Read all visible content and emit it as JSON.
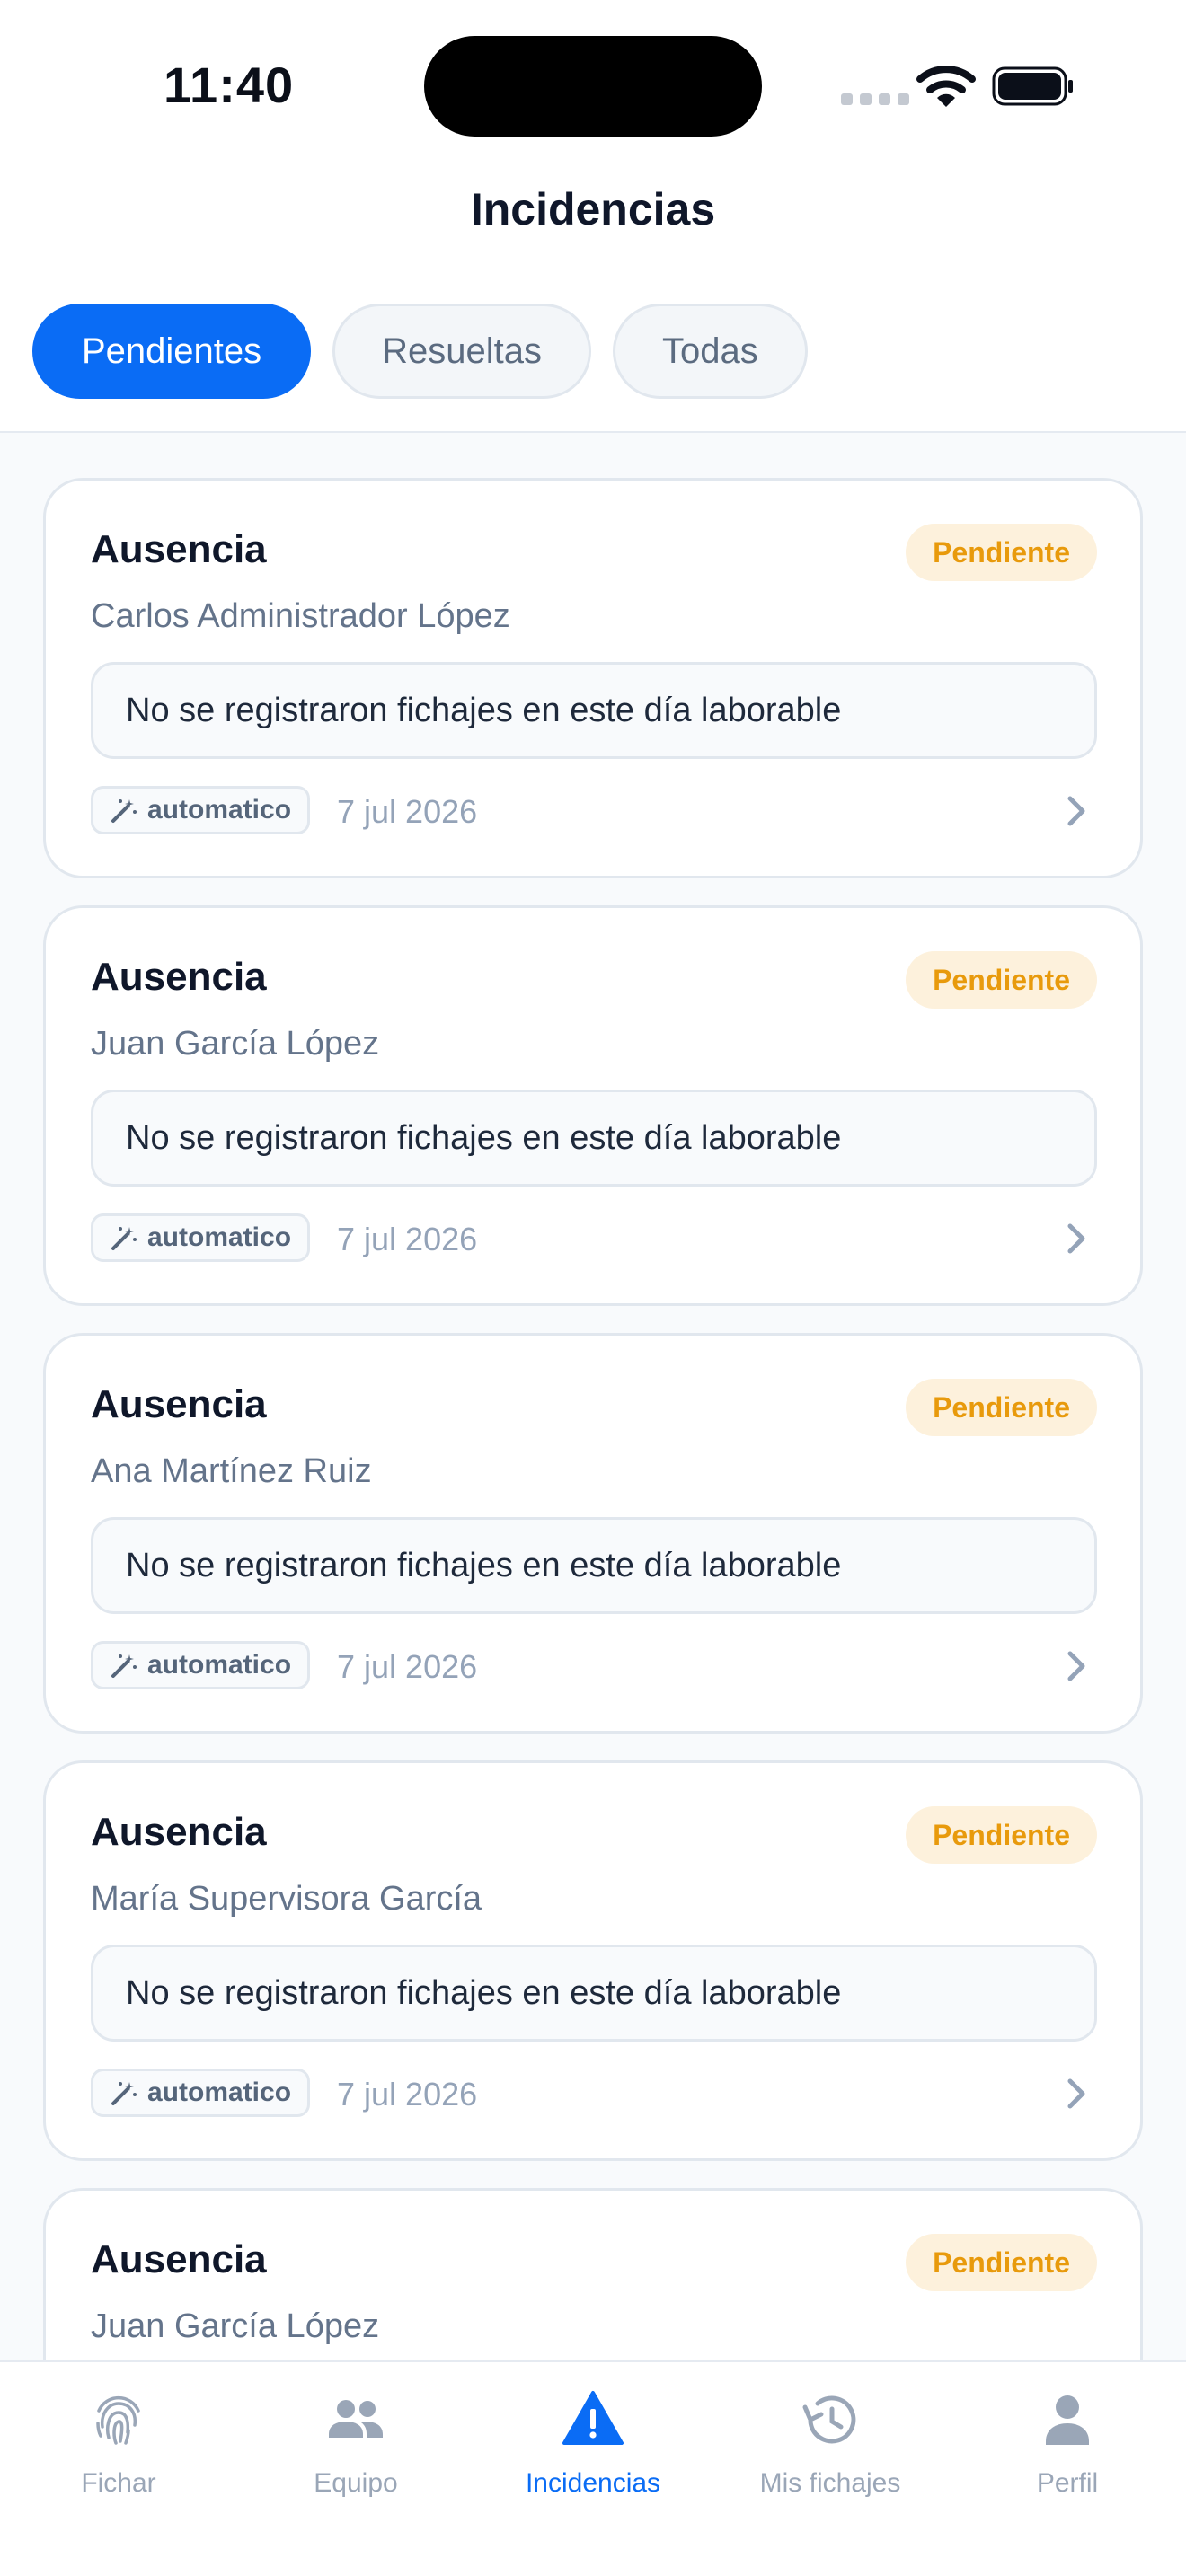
{
  "status_bar": {
    "time": "11:40"
  },
  "header": {
    "title": "Incidencias"
  },
  "tabs": [
    {
      "label": "Pendientes",
      "active": true
    },
    {
      "label": "Resueltas",
      "active": false
    },
    {
      "label": "Todas",
      "active": false
    }
  ],
  "cards": [
    {
      "type": "Ausencia",
      "status": "Pendiente",
      "person": "Carlos Administrador López",
      "description": "No se registraron fichajes en este día laborable",
      "origin": "automatico",
      "date": "7 jul 2026"
    },
    {
      "type": "Ausencia",
      "status": "Pendiente",
      "person": "Juan García López",
      "description": "No se registraron fichajes en este día laborable",
      "origin": "automatico",
      "date": "7 jul 2026"
    },
    {
      "type": "Ausencia",
      "status": "Pendiente",
      "person": "Ana Martínez Ruiz",
      "description": "No se registraron fichajes en este día laborable",
      "origin": "automatico",
      "date": "7 jul 2026"
    },
    {
      "type": "Ausencia",
      "status": "Pendiente",
      "person": "María Supervisora García",
      "description": "No se registraron fichajes en este día laborable",
      "origin": "automatico",
      "date": "7 jul 2026"
    },
    {
      "type": "Ausencia",
      "status": "Pendiente",
      "person": "Juan García López",
      "description": "",
      "origin": "",
      "date": ""
    }
  ],
  "nav": [
    {
      "label": "Fichar",
      "icon": "fingerprint-icon",
      "active": false
    },
    {
      "label": "Equipo",
      "icon": "team-icon",
      "active": false
    },
    {
      "label": "Incidencias",
      "icon": "warning-icon",
      "active": true
    },
    {
      "label": "Mis fichajes",
      "icon": "history-icon",
      "active": false
    },
    {
      "label": "Perfil",
      "icon": "person-icon",
      "active": false
    }
  ],
  "colors": {
    "accent": "#0a6cf5",
    "pending_text": "#e89a0c",
    "pending_bg": "#fdf1dc"
  }
}
